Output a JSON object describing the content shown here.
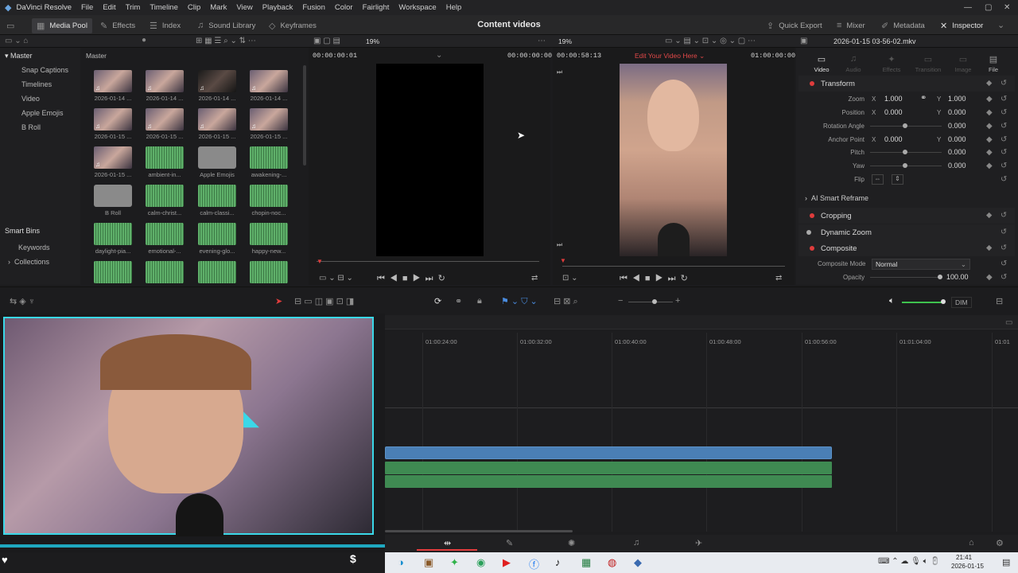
{
  "menubar": {
    "app": "DaVinci Resolve",
    "items": [
      "File",
      "Edit",
      "Trim",
      "Timeline",
      "Clip",
      "Mark",
      "View",
      "Playback",
      "Fusion",
      "Color",
      "Fairlight",
      "Workspace",
      "Help"
    ]
  },
  "toolbar": {
    "media_pool": "Media Pool",
    "effects": "Effects",
    "index": "Index",
    "sound_library": "Sound Library",
    "keyframes": "Keyframes",
    "project_title": "Content videos",
    "quick_export": "Quick Export",
    "mixer": "Mixer",
    "metadata": "Metadata",
    "inspector": "Inspector"
  },
  "subbar": {
    "zoom_left": "19%",
    "zoom_right": "19%",
    "clip_name": "2026-01-15 03-56-02.mkv"
  },
  "bins": {
    "master": "Master",
    "items": [
      "Snap Captions",
      "Timelines",
      "Video",
      "Apple Emojis",
      "B Roll"
    ],
    "smart_bins": "Smart Bins",
    "smart_items": [
      "Keywords",
      "Collections"
    ]
  },
  "pool": {
    "header": "Master",
    "clips": [
      "2026-01-14 ...",
      "2026-01-14 ...",
      "2026-01-14 ...",
      "2026-01-14 ...",
      "2026-01-15 ...",
      "2026-01-15 ...",
      "2026-01-15 ...",
      "2026-01-15 ...",
      "2026-01-15 ...",
      "ambient-in...",
      "Apple Emojis",
      "awakening-...",
      "B Roll",
      "calm-christ...",
      "calm-classi...",
      "chopin-noc...",
      "daylight-pia...",
      "emotional-...",
      "evening-glo...",
      "happy-new..."
    ]
  },
  "source": {
    "tc_left": "00:00:00:01",
    "tc_right": "00:00:00:00"
  },
  "timeline_viewer": {
    "tc_left": "00:00:58:13",
    "title": "Edit Your Video Here",
    "tc_right": "01:00:00:00"
  },
  "inspector": {
    "tabs": [
      "Video",
      "Audio",
      "Effects",
      "Transition",
      "Image",
      "File"
    ],
    "transform": "Transform",
    "zoom_label": "Zoom",
    "zoom_x": "1.000",
    "zoom_y": "1.000",
    "position_label": "Position",
    "pos_x": "0.000",
    "pos_y": "0.000",
    "rotation_label": "Rotation Angle",
    "rotation": "0.000",
    "anchor_label": "Anchor Point",
    "anchor_x": "0.000",
    "anchor_y": "0.000",
    "pitch_label": "Pitch",
    "pitch": "0.000",
    "yaw_label": "Yaw",
    "yaw": "0.000",
    "flip_label": "Flip",
    "x_axis": "X",
    "y_axis": "Y",
    "ai_reframe": "AI Smart Reframe",
    "cropping": "Cropping",
    "dynamic_zoom": "Dynamic Zoom",
    "composite": "Composite",
    "composite_mode_label": "Composite Mode",
    "composite_mode": "Normal",
    "opacity_label": "Opacity",
    "opacity": "100.00"
  },
  "timeline": {
    "ticks": [
      "01:00:24:00",
      "01:00:32:00",
      "01:00:40:00",
      "01:00:48:00",
      "01:00:56:00",
      "01:01:04:00",
      "01:01"
    ],
    "dim": "DIM"
  },
  "taskbar": {
    "time": "21:41",
    "date": "2026-01-15"
  },
  "colors": {
    "accent_red": "#e03c3c",
    "video_clip": "#4a7fb5",
    "audio_clip": "#3f8a52"
  }
}
